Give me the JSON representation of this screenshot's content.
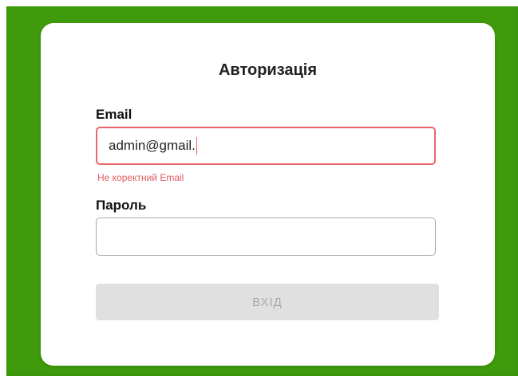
{
  "form": {
    "title": "Авторизація",
    "email_label": "Email",
    "email_value": "admin@gmail.",
    "email_error": "Не коректний Email",
    "password_label": "Пароль",
    "password_value": "",
    "submit_label": "ВХІД"
  },
  "colors": {
    "background": "#3f9b0b",
    "error": "#e96669",
    "disabled_button": "#e0e0e0"
  }
}
